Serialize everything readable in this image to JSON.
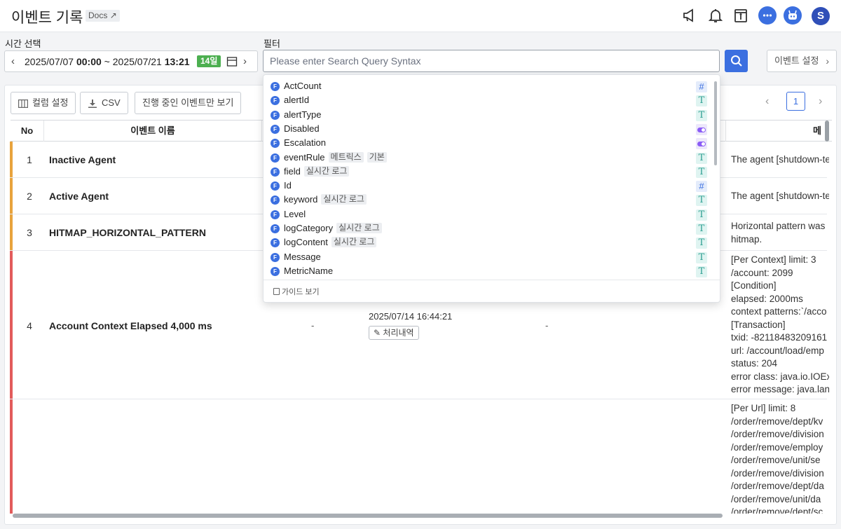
{
  "header": {
    "title": "이벤트 기록",
    "docs_label": "Docs",
    "icons": [
      "megaphone-icon",
      "bell-icon",
      "info-box-icon",
      "chat-icon",
      "bot-icon"
    ],
    "avatar_initial": "S"
  },
  "time_selector": {
    "label": "시간 선택",
    "start_date": "2025/07/07",
    "start_time": "00:00",
    "separator": "~",
    "end_date": "2025/07/21",
    "end_time": "13:21",
    "range_badge": "14일"
  },
  "filter": {
    "label": "필터",
    "placeholder": "Please enter Search Query Syntax",
    "value": ""
  },
  "event_settings_label": "이벤트 설정",
  "toolbar": {
    "column_settings": "컬럼 설정",
    "csv": "CSV",
    "show_ongoing": "진행 중인 이벤트만 보기"
  },
  "pagination": {
    "current_page": "1"
  },
  "table": {
    "columns": {
      "no": "No",
      "event_name": "이벤트 이름",
      "msg_partial": "메"
    },
    "rows": [
      {
        "no": "1",
        "name": "Inactive Agent",
        "message": "The agent [shutdown-te",
        "color": "#e8a33d"
      },
      {
        "no": "2",
        "name": "Active Agent",
        "message": "The agent [shutdown-te",
        "color": "#e8a33d"
      },
      {
        "no": "3",
        "name": "HITMAP_HORIZONTAL_PATTERN",
        "message": "Horizontal pattern was\nhitmap.",
        "color": "#e8a33d"
      },
      {
        "no": "4",
        "name": "Account Context Elapsed 4,000 ms",
        "dash1": "-",
        "date": "2025/07/14 16:44:21",
        "history_label": "처리내역",
        "dash2": "-",
        "message": "[Per Context] limit: 3\n/account: 2099\n[Condition]\nelapsed: 2000ms\ncontext patterns:`/acco\n[Transaction]\ntxid: -82118483209161\nurl: /account/load/emp\nstatus: 204\nerror class: java.io.IOEx\nerror message: java.lan",
        "color": "#e25c5c"
      },
      {
        "no": "",
        "name": "",
        "message": "[Per Url] limit: 8\n/order/remove/dept/kv\n/order/remove/division\n/order/remove/employ\n/order/remove/unit/se\n/order/remove/division\n/order/remove/dept/da\n/order/remove/unit/da\n/order/remove/dept/sc",
        "color": "#e25c5c"
      }
    ]
  },
  "suggestions": [
    {
      "label": "ActCount",
      "tags": [],
      "type": "number"
    },
    {
      "label": "alertId",
      "tags": [],
      "type": "text"
    },
    {
      "label": "alertType",
      "tags": [],
      "type": "text"
    },
    {
      "label": "Disabled",
      "tags": [],
      "type": "boolean"
    },
    {
      "label": "Escalation",
      "tags": [],
      "type": "boolean"
    },
    {
      "label": "eventRule",
      "tags": [
        "메트릭스",
        "기본"
      ],
      "type": "text"
    },
    {
      "label": "field",
      "tags": [
        "실시간 로그"
      ],
      "type": "text"
    },
    {
      "label": "Id",
      "tags": [],
      "type": "number"
    },
    {
      "label": "keyword",
      "tags": [
        "실시간 로그"
      ],
      "type": "text"
    },
    {
      "label": "Level",
      "tags": [],
      "type": "text"
    },
    {
      "label": "logCategory",
      "tags": [
        "실시간 로그"
      ],
      "type": "text"
    },
    {
      "label": "logContent",
      "tags": [
        "실시간 로그"
      ],
      "type": "text"
    },
    {
      "label": "Message",
      "tags": [],
      "type": "text"
    },
    {
      "label": "MetricName",
      "tags": [],
      "type": "text"
    }
  ],
  "suggestion_badge": "F",
  "type_glyphs": {
    "number": "#",
    "text": "T"
  },
  "guide_label": "가이드 보기"
}
